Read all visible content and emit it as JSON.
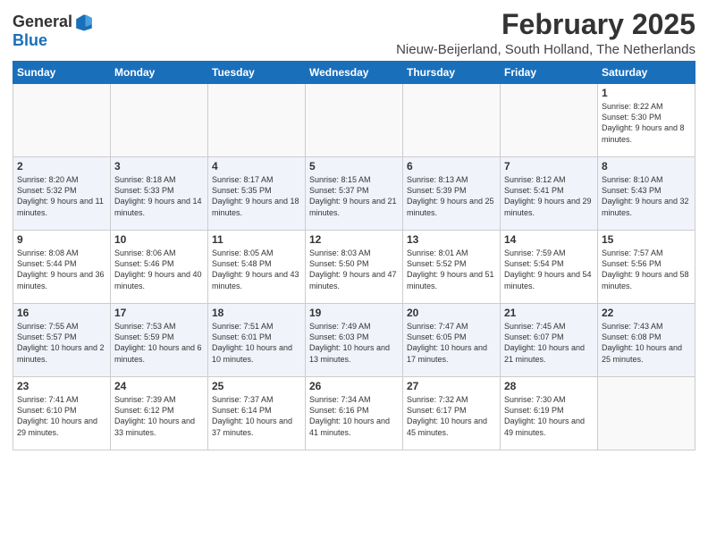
{
  "logo": {
    "general": "General",
    "blue": "Blue"
  },
  "title": "February 2025",
  "location": "Nieuw-Beijerland, South Holland, The Netherlands",
  "weekdays": [
    "Sunday",
    "Monday",
    "Tuesday",
    "Wednesday",
    "Thursday",
    "Friday",
    "Saturday"
  ],
  "weeks": [
    [
      {
        "day": "",
        "info": ""
      },
      {
        "day": "",
        "info": ""
      },
      {
        "day": "",
        "info": ""
      },
      {
        "day": "",
        "info": ""
      },
      {
        "day": "",
        "info": ""
      },
      {
        "day": "",
        "info": ""
      },
      {
        "day": "1",
        "info": "Sunrise: 8:22 AM\nSunset: 5:30 PM\nDaylight: 9 hours and 8 minutes."
      }
    ],
    [
      {
        "day": "2",
        "info": "Sunrise: 8:20 AM\nSunset: 5:32 PM\nDaylight: 9 hours and 11 minutes."
      },
      {
        "day": "3",
        "info": "Sunrise: 8:18 AM\nSunset: 5:33 PM\nDaylight: 9 hours and 14 minutes."
      },
      {
        "day": "4",
        "info": "Sunrise: 8:17 AM\nSunset: 5:35 PM\nDaylight: 9 hours and 18 minutes."
      },
      {
        "day": "5",
        "info": "Sunrise: 8:15 AM\nSunset: 5:37 PM\nDaylight: 9 hours and 21 minutes."
      },
      {
        "day": "6",
        "info": "Sunrise: 8:13 AM\nSunset: 5:39 PM\nDaylight: 9 hours and 25 minutes."
      },
      {
        "day": "7",
        "info": "Sunrise: 8:12 AM\nSunset: 5:41 PM\nDaylight: 9 hours and 29 minutes."
      },
      {
        "day": "8",
        "info": "Sunrise: 8:10 AM\nSunset: 5:43 PM\nDaylight: 9 hours and 32 minutes."
      }
    ],
    [
      {
        "day": "9",
        "info": "Sunrise: 8:08 AM\nSunset: 5:44 PM\nDaylight: 9 hours and 36 minutes."
      },
      {
        "day": "10",
        "info": "Sunrise: 8:06 AM\nSunset: 5:46 PM\nDaylight: 9 hours and 40 minutes."
      },
      {
        "day": "11",
        "info": "Sunrise: 8:05 AM\nSunset: 5:48 PM\nDaylight: 9 hours and 43 minutes."
      },
      {
        "day": "12",
        "info": "Sunrise: 8:03 AM\nSunset: 5:50 PM\nDaylight: 9 hours and 47 minutes."
      },
      {
        "day": "13",
        "info": "Sunrise: 8:01 AM\nSunset: 5:52 PM\nDaylight: 9 hours and 51 minutes."
      },
      {
        "day": "14",
        "info": "Sunrise: 7:59 AM\nSunset: 5:54 PM\nDaylight: 9 hours and 54 minutes."
      },
      {
        "day": "15",
        "info": "Sunrise: 7:57 AM\nSunset: 5:56 PM\nDaylight: 9 hours and 58 minutes."
      }
    ],
    [
      {
        "day": "16",
        "info": "Sunrise: 7:55 AM\nSunset: 5:57 PM\nDaylight: 10 hours and 2 minutes."
      },
      {
        "day": "17",
        "info": "Sunrise: 7:53 AM\nSunset: 5:59 PM\nDaylight: 10 hours and 6 minutes."
      },
      {
        "day": "18",
        "info": "Sunrise: 7:51 AM\nSunset: 6:01 PM\nDaylight: 10 hours and 10 minutes."
      },
      {
        "day": "19",
        "info": "Sunrise: 7:49 AM\nSunset: 6:03 PM\nDaylight: 10 hours and 13 minutes."
      },
      {
        "day": "20",
        "info": "Sunrise: 7:47 AM\nSunset: 6:05 PM\nDaylight: 10 hours and 17 minutes."
      },
      {
        "day": "21",
        "info": "Sunrise: 7:45 AM\nSunset: 6:07 PM\nDaylight: 10 hours and 21 minutes."
      },
      {
        "day": "22",
        "info": "Sunrise: 7:43 AM\nSunset: 6:08 PM\nDaylight: 10 hours and 25 minutes."
      }
    ],
    [
      {
        "day": "23",
        "info": "Sunrise: 7:41 AM\nSunset: 6:10 PM\nDaylight: 10 hours and 29 minutes."
      },
      {
        "day": "24",
        "info": "Sunrise: 7:39 AM\nSunset: 6:12 PM\nDaylight: 10 hours and 33 minutes."
      },
      {
        "day": "25",
        "info": "Sunrise: 7:37 AM\nSunset: 6:14 PM\nDaylight: 10 hours and 37 minutes."
      },
      {
        "day": "26",
        "info": "Sunrise: 7:34 AM\nSunset: 6:16 PM\nDaylight: 10 hours and 41 minutes."
      },
      {
        "day": "27",
        "info": "Sunrise: 7:32 AM\nSunset: 6:17 PM\nDaylight: 10 hours and 45 minutes."
      },
      {
        "day": "28",
        "info": "Sunrise: 7:30 AM\nSunset: 6:19 PM\nDaylight: 10 hours and 49 minutes."
      },
      {
        "day": "",
        "info": ""
      }
    ]
  ]
}
